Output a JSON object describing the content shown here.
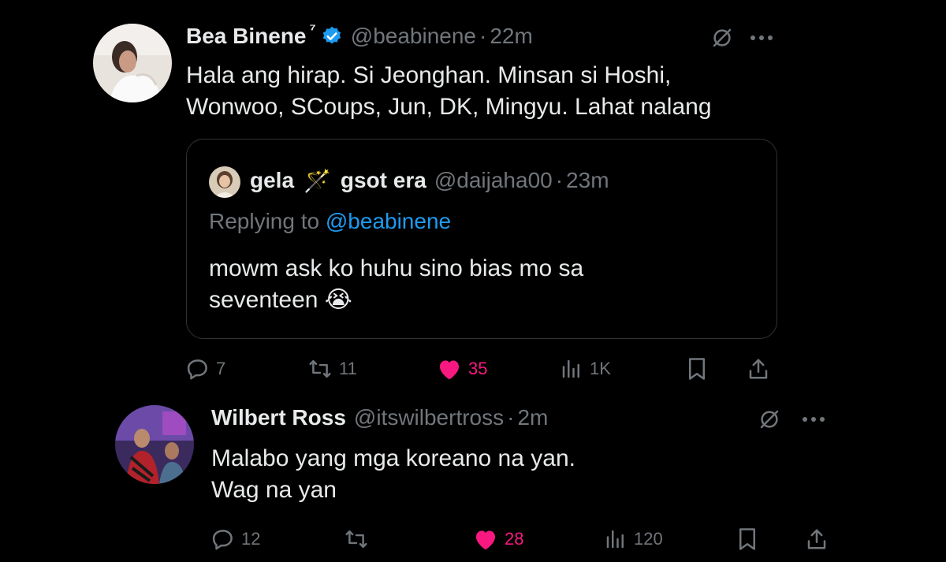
{
  "tweet1": {
    "display_name": "Bea Binene",
    "name_suffix": "⁷",
    "handle": "@beabinene",
    "separator": "·",
    "time": "22m",
    "text_line1": "Hala ang hirap. Si Jeonghan. Minsan si Hoshi,",
    "text_line2": "Wonwoo, SCoups, Jun, DK, Mingyu. Lahat nalang",
    "quote": {
      "name_part1": "gela",
      "name_emoji": "🪄",
      "name_part2": "gsot era",
      "handle": "@daijaha00",
      "separator": "·",
      "time": "23m",
      "replying_prefix": "Replying to",
      "replying_handle": "@beabinene",
      "text_line1": "mowm ask ko huhu sino bias mo sa",
      "text_line2": "seventeen",
      "text_emoji": "😭"
    },
    "actions": {
      "replies": "7",
      "reposts": "11",
      "likes": "35",
      "views": "1K"
    }
  },
  "tweet2": {
    "display_name": "Wilbert Ross",
    "handle": "@itswilbertross",
    "separator": "·",
    "time": "2m",
    "text_line1": "Malabo yang mga koreano na yan.",
    "text_line2": "Wag na yan",
    "actions": {
      "replies": "12",
      "reposts": "",
      "likes": "28",
      "views": "120"
    }
  },
  "colors": {
    "background": "#000000",
    "text": "#e7e9ea",
    "muted": "#71767b",
    "link": "#1d9bf0",
    "like": "#f91880",
    "verified": "#1d9bf0"
  },
  "icons": [
    "verified-badge-icon",
    "grok-icon",
    "more-icon",
    "reply-icon",
    "repost-icon",
    "heart-icon",
    "views-icon",
    "bookmark-icon",
    "share-icon"
  ]
}
